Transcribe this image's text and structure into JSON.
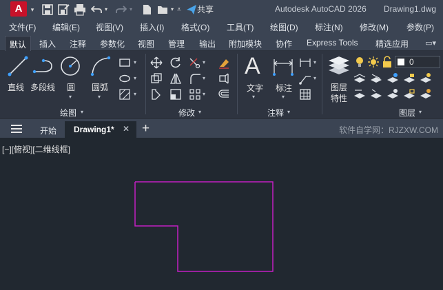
{
  "titlebar": {
    "app_logo": "A",
    "share_label": "共享",
    "app_name": "Autodesk AutoCAD 2026",
    "document": "Drawing1.dwg",
    "icons": [
      "app-logo",
      "dropdown-chevron",
      "save-icon",
      "save-as-icon",
      "print-icon",
      "undo-icon",
      "redo-icon",
      "new-file-icon",
      "open-folder-icon",
      "share-icon"
    ]
  },
  "menubar": {
    "items": [
      "文件(F)",
      "编辑(E)",
      "视图(V)",
      "插入(I)",
      "格式(O)",
      "工具(T)",
      "绘图(D)",
      "标注(N)",
      "修改(M)",
      "参数(P)"
    ]
  },
  "ribbon_tabs": {
    "items": [
      "默认",
      "插入",
      "注释",
      "参数化",
      "视图",
      "管理",
      "输出",
      "附加模块",
      "协作",
      "Express Tools",
      "精选应用"
    ],
    "active": "默认"
  },
  "ribbon": {
    "draw": {
      "title": "绘图",
      "line": "直线",
      "polyline": "多段线",
      "circle": "圆",
      "arc": "圆弧"
    },
    "modify": {
      "title": "修改"
    },
    "annotation": {
      "title": "注释",
      "text": "文字",
      "dimension": "标注"
    },
    "layers": {
      "title": "图层",
      "properties_line1": "图层",
      "properties_line2": "特性",
      "current_layer": "0",
      "current_color": "#ffffff"
    }
  },
  "filetabs": {
    "start": "开始",
    "current": "Drawing1*",
    "watermark": "软件自学网：RJZXW.COM"
  },
  "canvas": {
    "viewport_label": "[−][俯视][二维线框]",
    "shape_color": "#c21fc2"
  },
  "colors": {
    "titlebar": "#3b4453",
    "ribbon": "#2e3440",
    "canvas": "#212830",
    "accent": "#c7122a"
  }
}
